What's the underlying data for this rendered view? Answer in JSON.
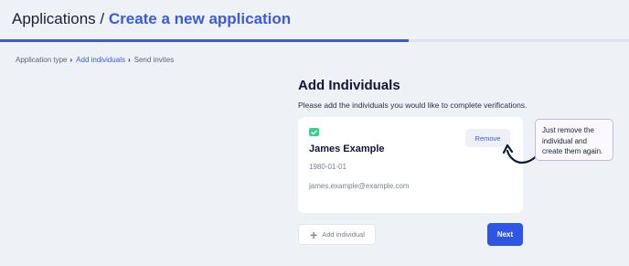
{
  "header": {
    "title_prefix": "Applications / ",
    "title_main": "Create a new application",
    "progress": 0.65
  },
  "breadcrumb": {
    "items": [
      {
        "label": "Application type",
        "active": false
      },
      {
        "label": "Add individuals",
        "active": true
      },
      {
        "label": "Send invites",
        "active": false
      }
    ]
  },
  "main": {
    "title": "Add Individuals",
    "description": "Please add the individuals you would like to complete verifications."
  },
  "individual": {
    "status_icon": "check-icon",
    "name": "James Example",
    "dob": "1980-01-01",
    "email": "james.example@example.com",
    "remove_label": "Remove"
  },
  "tooltip": {
    "text": "Just remove the individual and create them again."
  },
  "actions": {
    "add_label": "Add individual",
    "add_icon": "plus-icon",
    "next_label": "Next"
  },
  "colors": {
    "accent": "#3b5bdb",
    "primary_button": "#2f55e4",
    "success": "#3ecf8e",
    "background": "#eef1f6"
  }
}
